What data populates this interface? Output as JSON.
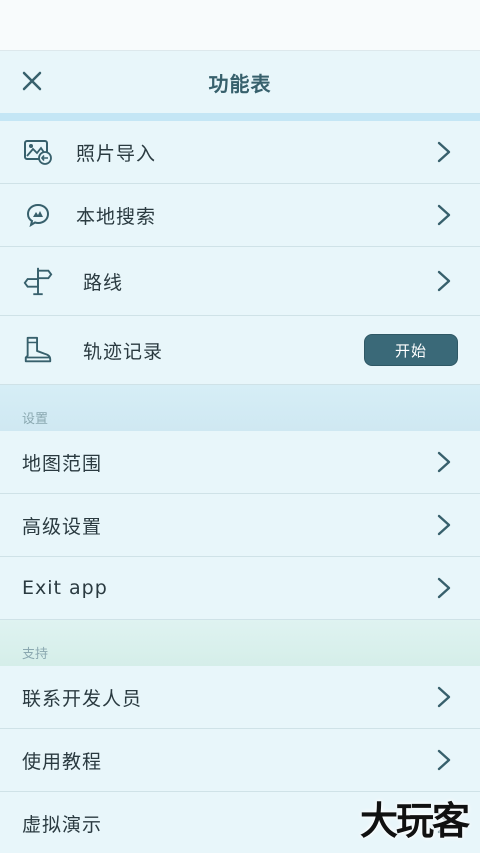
{
  "header": {
    "title": "功能表"
  },
  "menu": [
    {
      "label": "照片导入"
    },
    {
      "label": "本地搜索"
    },
    {
      "label": "路线"
    },
    {
      "label": "轨迹记录",
      "button": "开始"
    }
  ],
  "settings": {
    "section_label": "设置",
    "items": [
      {
        "label": "地图范围"
      },
      {
        "label": "高级设置"
      },
      {
        "label": "Exit app"
      }
    ]
  },
  "support": {
    "section_label": "支持",
    "items": [
      {
        "label": "联系开发人员"
      },
      {
        "label": "使用教程"
      },
      {
        "label": "虚拟演示"
      }
    ]
  },
  "watermark": "大玩客",
  "colors": {
    "accent": "#3a6978",
    "background": "#e8f6fa"
  }
}
